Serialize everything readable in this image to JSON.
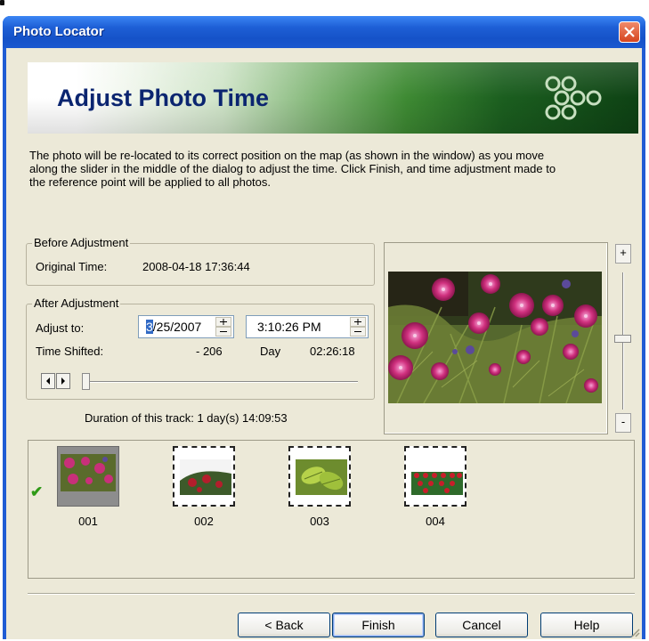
{
  "window": {
    "title": "Photo Locator"
  },
  "banner": {
    "title": "Adjust Photo Time"
  },
  "description": [
    "The photo will be re-located to its correct position on the map (as shown in the window) as you move",
    "along the slider in the middle of the dialog to adjust the time. Click Finish, and time adjustment made to",
    "the reference point will be applied to all photos."
  ],
  "before": {
    "legend": "Before Adjustment",
    "original_label": "Original Time:",
    "original_value": "2008-04-18 17:36:44"
  },
  "after": {
    "legend": "After Adjustment",
    "adjust_label": "Adjust to:",
    "date_selected_digit": "3",
    "date_rest": "/25/2007",
    "time_value": "3:10:26 PM",
    "shifted_label": "Time Shifted:",
    "shifted_value": "- 206",
    "shifted_unit": "Day",
    "shifted_time": "02:26:18",
    "slider_position": 0.0
  },
  "duration": "Duration of this track:  1 day(s) 14:09:53",
  "zoom": {
    "in_label": "+",
    "out_label": "-",
    "level": 0.52
  },
  "thumbnails": [
    {
      "label": "001",
      "selected": true,
      "checked": true
    },
    {
      "label": "002",
      "selected": false,
      "checked": false
    },
    {
      "label": "003",
      "selected": false,
      "checked": false
    },
    {
      "label": "004",
      "selected": false,
      "checked": false
    }
  ],
  "buttons": {
    "back": "< Back",
    "finish": "Finish",
    "cancel": "Cancel",
    "help": "Help"
  },
  "colors": {
    "title_bar": "#1f5cd4",
    "banner_text": "#0b2570",
    "dialog_bg": "#ece9d8",
    "check": "#2f9a17"
  }
}
